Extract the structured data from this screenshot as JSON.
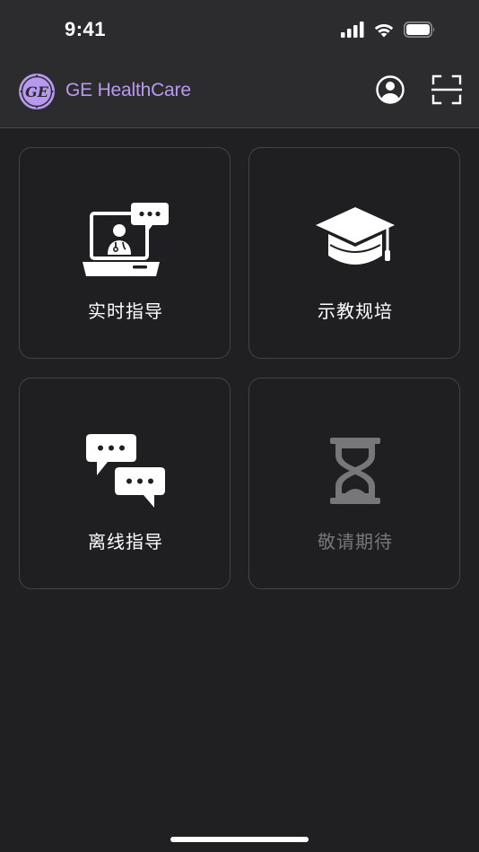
{
  "status_bar": {
    "time": "9:41",
    "icons": [
      "cellular-signal-icon",
      "wifi-icon",
      "battery-icon"
    ]
  },
  "header": {
    "logo_text": "GE",
    "brand": "GE HealthCare",
    "brand_color": "#b79af0",
    "actions": [
      "profile-icon",
      "scan-icon"
    ]
  },
  "cards": [
    {
      "label": "实时指导",
      "icon": "video-consult-icon",
      "enabled": true
    },
    {
      "label": "示教规培",
      "icon": "graduation-cap-icon",
      "enabled": true
    },
    {
      "label": "离线指导",
      "icon": "chat-bubbles-icon",
      "enabled": true
    },
    {
      "label": "敬请期待",
      "icon": "hourglass-icon",
      "enabled": false
    }
  ],
  "colors": {
    "background": "#202022",
    "header_background": "#2c2c2e",
    "card_border": "#444446",
    "disabled_text": "#77777a"
  }
}
